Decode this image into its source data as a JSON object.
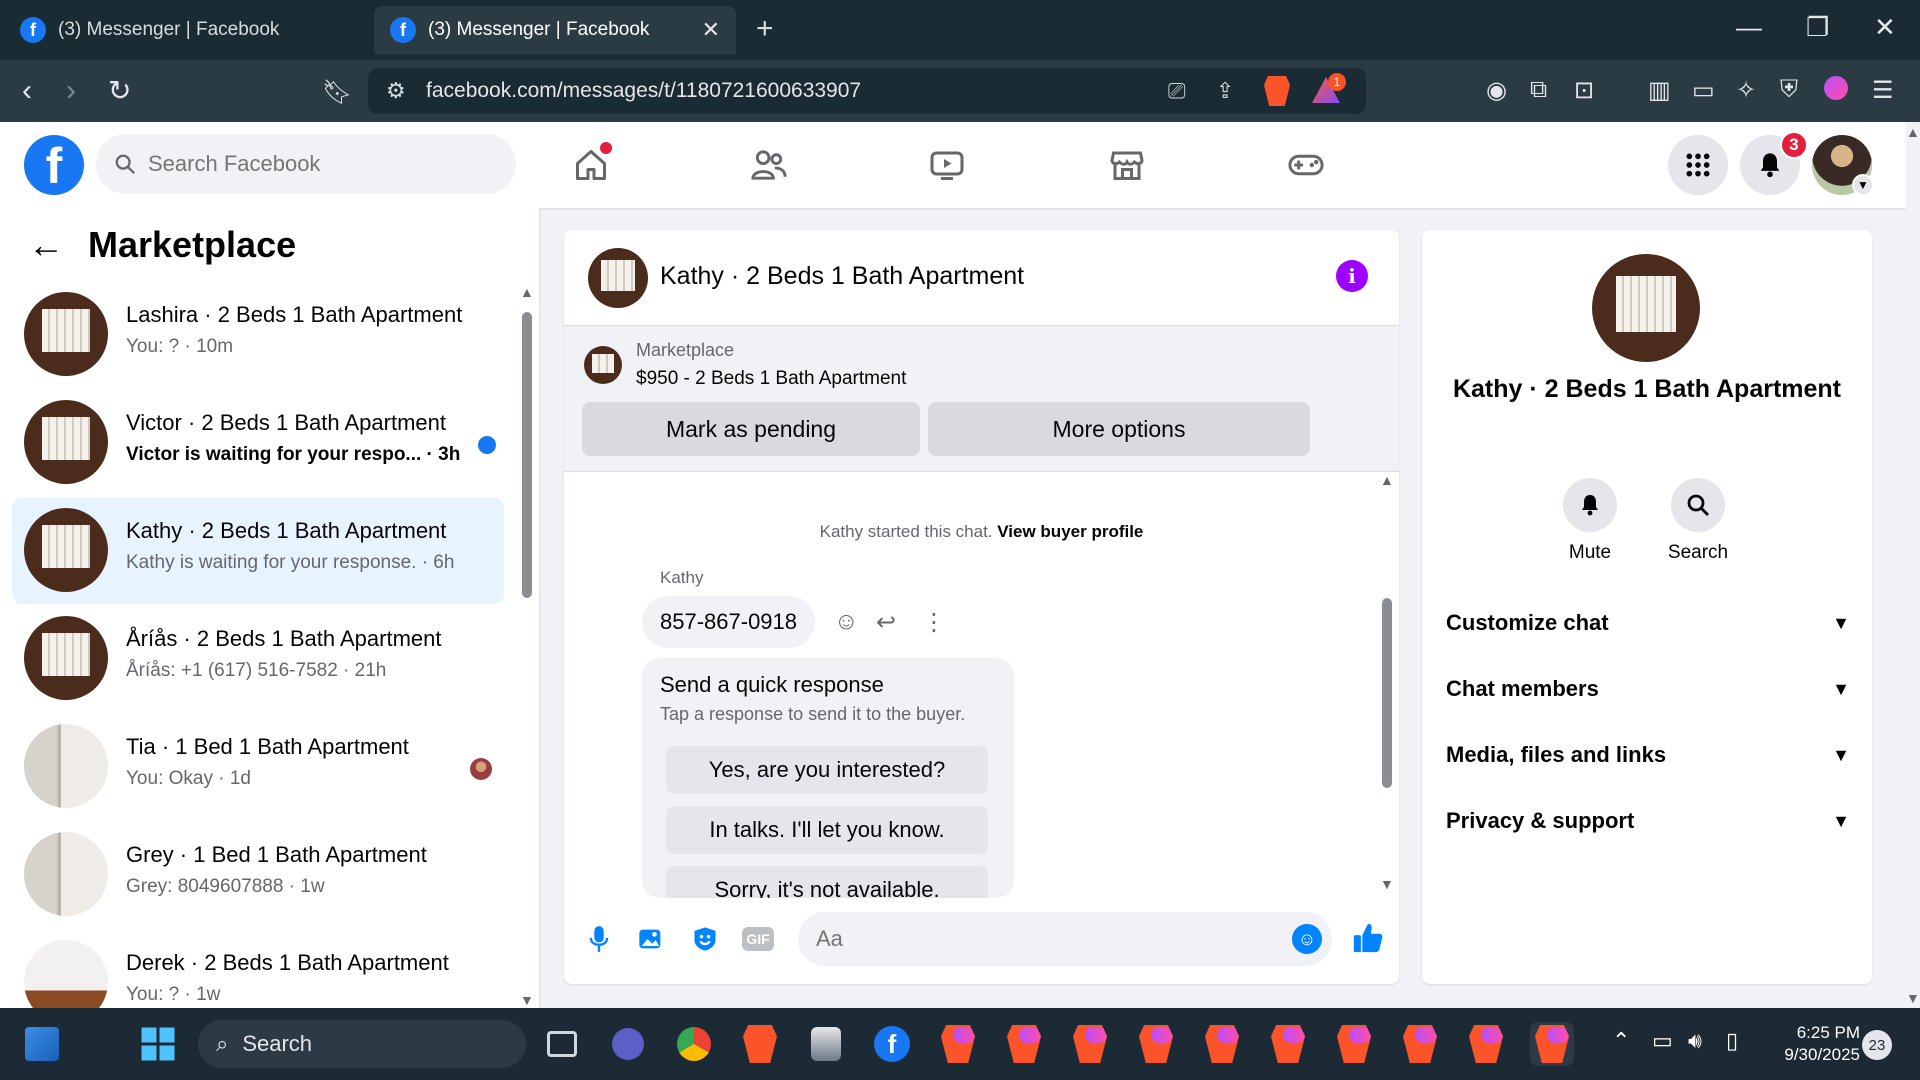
{
  "browser": {
    "tabs": [
      {
        "title": "(3) Messenger | Facebook",
        "active": false
      },
      {
        "title": "(3) Messenger | Facebook",
        "active": true
      }
    ],
    "url": "facebook.com/messages/t/1180721600633907",
    "rewards_badge": "1"
  },
  "header": {
    "search_placeholder": "Search Facebook",
    "notifications_count": "3",
    "nav_icons": [
      "home-icon",
      "friends-icon",
      "video-icon",
      "marketplace-icon",
      "gaming-icon"
    ]
  },
  "sidebar": {
    "title": "Marketplace",
    "conversations": [
      {
        "name": "Lashira · 2 Beds 1 Bath Apartment",
        "snippet": "You: ? · 10m",
        "thumb": "window",
        "unread": false
      },
      {
        "name": "Victor · 2 Beds 1 Bath Apartment",
        "snippet": "Victor is waiting for your respo... · 3h",
        "thumb": "window",
        "unread": true
      },
      {
        "name": "Kathy · 2 Beds 1 Bath Apartment",
        "snippet": "Kathy is waiting for your response. · 6h",
        "thumb": "window",
        "unread": false,
        "selected": true
      },
      {
        "name": "Åríås · 2 Beds 1 Bath Apartment",
        "snippet": "Åríås: +1 (617) 516-7582 · 21h",
        "thumb": "window",
        "unread": false
      },
      {
        "name": "Tia · 1 Bed 1 Bath Apartment",
        "snippet": "You: Okay · 1d",
        "thumb": "door",
        "unread": false,
        "read_receipt": true
      },
      {
        "name": "Grey · 1 Bed 1 Bath Apartment",
        "snippet": "Grey: 8049607888 · 1w",
        "thumb": "door",
        "unread": false
      },
      {
        "name": "Derek · 2 Beds 1 Bath Apartment",
        "snippet": "You: ? · 1w",
        "thumb": "room",
        "unread": false
      }
    ]
  },
  "chat": {
    "title": "Kathy · 2 Beds 1 Bath Apartment",
    "marketplace_label": "Marketplace",
    "listing": "$950 - 2 Beds 1 Bath Apartment",
    "mark_pending": "Mark as pending",
    "more_options": "More options",
    "started_text": "Kathy started this chat.",
    "view_profile": "View buyer profile",
    "sender": "Kathy",
    "message": "857-867-0918",
    "quick_title": "Send a quick response",
    "quick_sub": "Tap a response to send it to the buyer.",
    "quick_options": [
      "Yes, are you interested?",
      "In talks. I'll let you know.",
      "Sorry, it's not available."
    ],
    "composer_placeholder": "Aa"
  },
  "right_panel": {
    "name": "Kathy · 2 Beds 1 Bath Apartment",
    "mute": "Mute",
    "search": "Search",
    "sections": [
      "Customize chat",
      "Chat members",
      "Media, files and links",
      "Privacy & support"
    ]
  },
  "taskbar": {
    "search_label": "Search",
    "time": "6:25 PM",
    "date": "9/30/2025",
    "notification_count": "23"
  },
  "colors": {
    "accent": "#1877f2",
    "messenger_blue": "#0084ff",
    "info_purple": "#9d00ff",
    "badge_red": "#e41e3f",
    "selected_bg": "#e7f3ff"
  }
}
